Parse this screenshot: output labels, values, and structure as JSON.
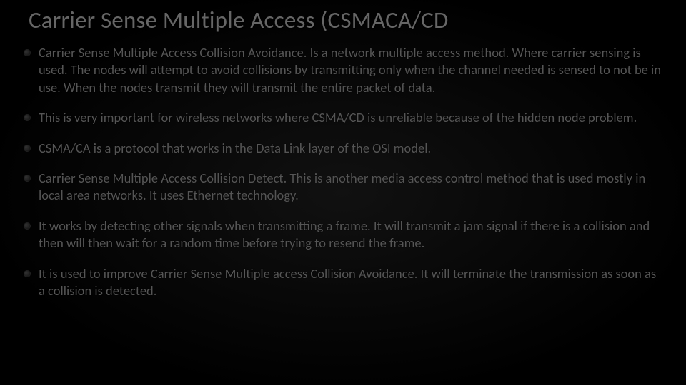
{
  "slide": {
    "title": "Carrier Sense Multiple Access (CSMACA/CD",
    "bullets": [
      "Carrier Sense Multiple Access Collision Avoidance. Is a network multiple access method. Where carrier sensing is used. The nodes will attempt to avoid collisions by transmitting only when the channel needed is sensed to not be in use. When the nodes transmit they will transmit the entire packet of data.",
      "This is very important for wireless networks where CSMA/CD is unreliable because of the hidden node problem.",
      "CSMA/CA is a protocol that works in the Data Link layer of the OSI model.",
      "Carrier Sense Multiple Access Collision Detect. This is another media access control method that is used mostly in local area networks. It uses Ethernet technology.",
      "It works by detecting other signals when transmitting a frame. It will transmit a jam signal if there is a collision and then will then wait for a random time before trying to resend the frame.",
      "It is used to improve Carrier Sense Multiple access Collision Avoidance. It will terminate the transmission as soon as a collision is detected."
    ]
  }
}
